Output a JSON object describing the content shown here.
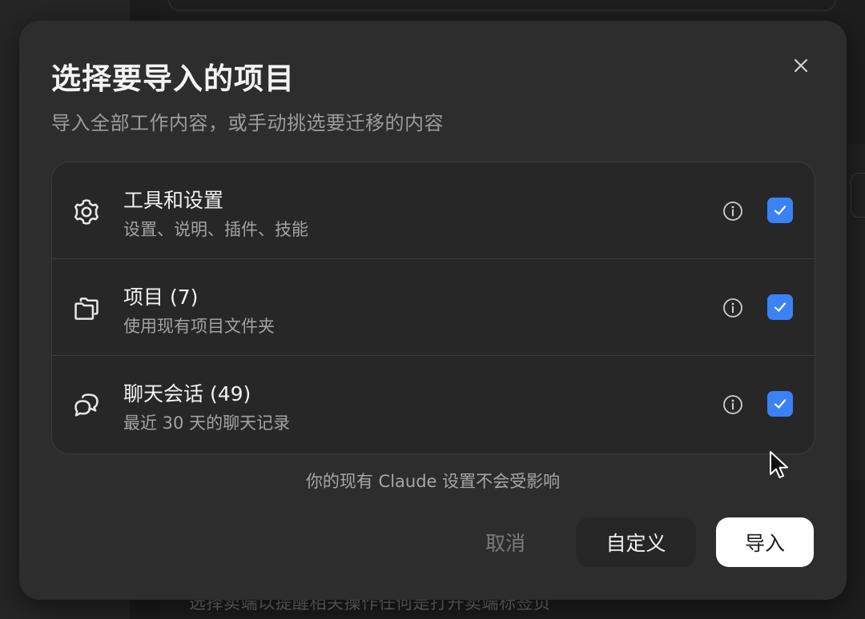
{
  "background": {
    "hint_text": "选择卖端以提醒相关操作任何是打开卖端标签页"
  },
  "dialog": {
    "title": "选择要导入的项目",
    "subtitle": "导入全部工作内容，或手动挑选要迁移的内容",
    "close_icon": "close-icon",
    "items": [
      {
        "icon": "gear-icon",
        "title": "工具和设置",
        "description": "设置、说明、插件、技能",
        "checked": true
      },
      {
        "icon": "folders-icon",
        "title": "项目 (7)",
        "description": "使用现有项目文件夹",
        "checked": true
      },
      {
        "icon": "chat-bubbles-icon",
        "title": "聊天会话 (49)",
        "description": "最近 30 天的聊天记录",
        "checked": true
      }
    ],
    "note": "你的现有 Claude 设置不会受影响",
    "buttons": {
      "cancel": "取消",
      "customize": "自定义",
      "import": "导入"
    }
  },
  "colors": {
    "accent": "#3b82f6",
    "dialog_bg": "#2d2d2d",
    "primary_button_bg": "#ffffff"
  }
}
